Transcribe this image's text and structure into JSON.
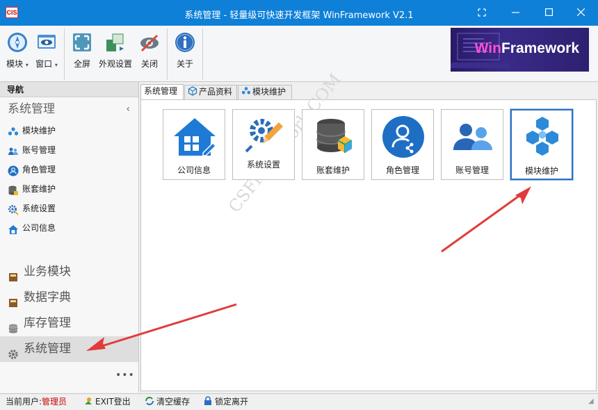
{
  "window": {
    "app_icon_text": "CIS",
    "title": "系统管理 - 轻量级可快速开发框架 WinFramework V2.1"
  },
  "ribbon": {
    "buttons": [
      {
        "label": "模块",
        "icon": "compass-icon"
      },
      {
        "label": "窗口",
        "icon": "window-icon"
      },
      {
        "label": "全屏",
        "icon": "fullscreen-icon"
      },
      {
        "label": "外观设置",
        "icon": "appearance-icon"
      },
      {
        "label": "关闭",
        "icon": "eye-close-icon"
      },
      {
        "label": "关于",
        "icon": "info-icon"
      }
    ],
    "brand_prefix": "Win",
    "brand_suffix": "Framework"
  },
  "nav": {
    "header": "导航",
    "group_title": "系统管理",
    "items": [
      {
        "label": "模块维护",
        "icon": "module-icon"
      },
      {
        "label": "账号管理",
        "icon": "users-icon"
      },
      {
        "label": "角色管理",
        "icon": "role-icon"
      },
      {
        "label": "账套维护",
        "icon": "database-icon"
      },
      {
        "label": "系统设置",
        "icon": "gear-icon"
      },
      {
        "label": "公司信息",
        "icon": "company-icon"
      }
    ],
    "sections": [
      {
        "label": "业务模块",
        "icon": "book-icon"
      },
      {
        "label": "数据字典",
        "icon": "book-icon"
      },
      {
        "label": "库存管理",
        "icon": "database-icon"
      },
      {
        "label": "系统管理",
        "icon": "gear-icon"
      }
    ],
    "more": "•••"
  },
  "tabs": [
    {
      "label": "系统管理"
    },
    {
      "label": "产品资料"
    },
    {
      "label": "模块维护"
    }
  ],
  "tiles": [
    {
      "label": "公司信息",
      "icon": "company-icon"
    },
    {
      "label": "系统设置",
      "icon": "settings-icon"
    },
    {
      "label": "账套维护",
      "icon": "database-icon"
    },
    {
      "label": "角色管理",
      "icon": "role-icon"
    },
    {
      "label": "账号管理",
      "icon": "users-icon"
    },
    {
      "label": "模块维护",
      "icon": "module-icon"
    }
  ],
  "watermark": "CSFramework.COM",
  "status": {
    "user_label": "当前用户:",
    "user_name": "管理员",
    "exit": "EXIT登出",
    "clear_cache": "清空缓存",
    "lock": "锁定离开"
  },
  "colors": {
    "titlebar": "#0f80d8",
    "accent": "#2d6fbd",
    "arrow": "#e23b3b"
  }
}
